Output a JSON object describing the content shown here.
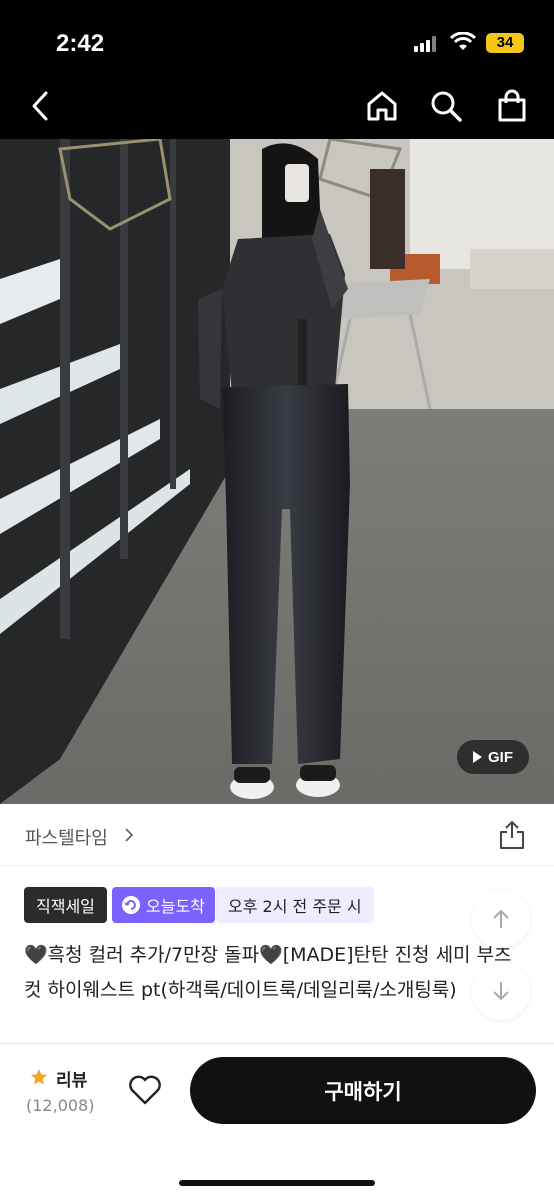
{
  "status_bar": {
    "time": "2:42",
    "battery": "34"
  },
  "nav": {
    "back_icon": "chevron-left-icon",
    "home_icon": "home-icon",
    "search_icon": "search-icon",
    "cart_icon": "shopping-bag-icon"
  },
  "hero": {
    "badge_label": "GIF"
  },
  "brand": {
    "name": "파스텔타임"
  },
  "tags": {
    "sale": "직잭세일",
    "arrive": "오늘도착",
    "time": "오후 2시 전 주문 시"
  },
  "product": {
    "title": "🖤흑청 컬러 추가/7만장 돌파🖤[MADE]탄탄 진청 세미 부츠컷 하이웨스트 pt(하객룩/데이트룩/데일리룩/소개팅룩)"
  },
  "bottom": {
    "review_label": "리뷰",
    "review_count": "(12,008)",
    "buy_label": "구매하기"
  },
  "colors": {
    "accent_purple": "#7b61ff",
    "star": "#f5a623",
    "dark": "#111111"
  }
}
